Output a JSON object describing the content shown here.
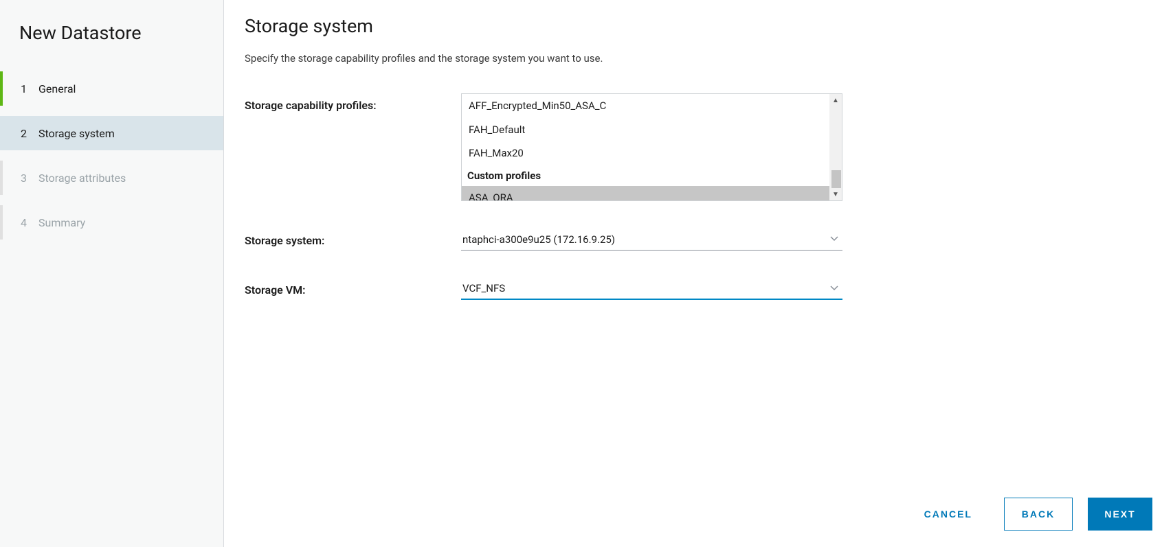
{
  "sidebar": {
    "title": "New Datastore",
    "steps": [
      {
        "num": "1",
        "label": "General",
        "state": "completed"
      },
      {
        "num": "2",
        "label": "Storage system",
        "state": "active"
      },
      {
        "num": "3",
        "label": "Storage attributes",
        "state": "upcoming"
      },
      {
        "num": "4",
        "label": "Summary",
        "state": "upcoming"
      }
    ]
  },
  "page": {
    "title": "Storage system",
    "description": "Specify the storage capability profiles and the storage system you want to use."
  },
  "form": {
    "profiles_label": "Storage capability profiles:",
    "storage_system_label": "Storage system:",
    "storage_vm_label": "Storage VM:",
    "profiles": {
      "items": [
        {
          "text": "AFF_Encrypted_Min50_ASA_C",
          "type": "item"
        },
        {
          "text": "FAH_Default",
          "type": "item"
        },
        {
          "text": "FAH_Max20",
          "type": "item"
        },
        {
          "text": "Custom profiles",
          "type": "heading"
        },
        {
          "text": "ASA_ORA",
          "type": "item",
          "selected": true
        }
      ]
    },
    "storage_system_value": "ntaphci-a300e9u25 (172.16.9.25)",
    "storage_vm_value": "VCF_NFS"
  },
  "footer": {
    "cancel": "CANCEL",
    "back": "BACK",
    "next": "NEXT"
  }
}
